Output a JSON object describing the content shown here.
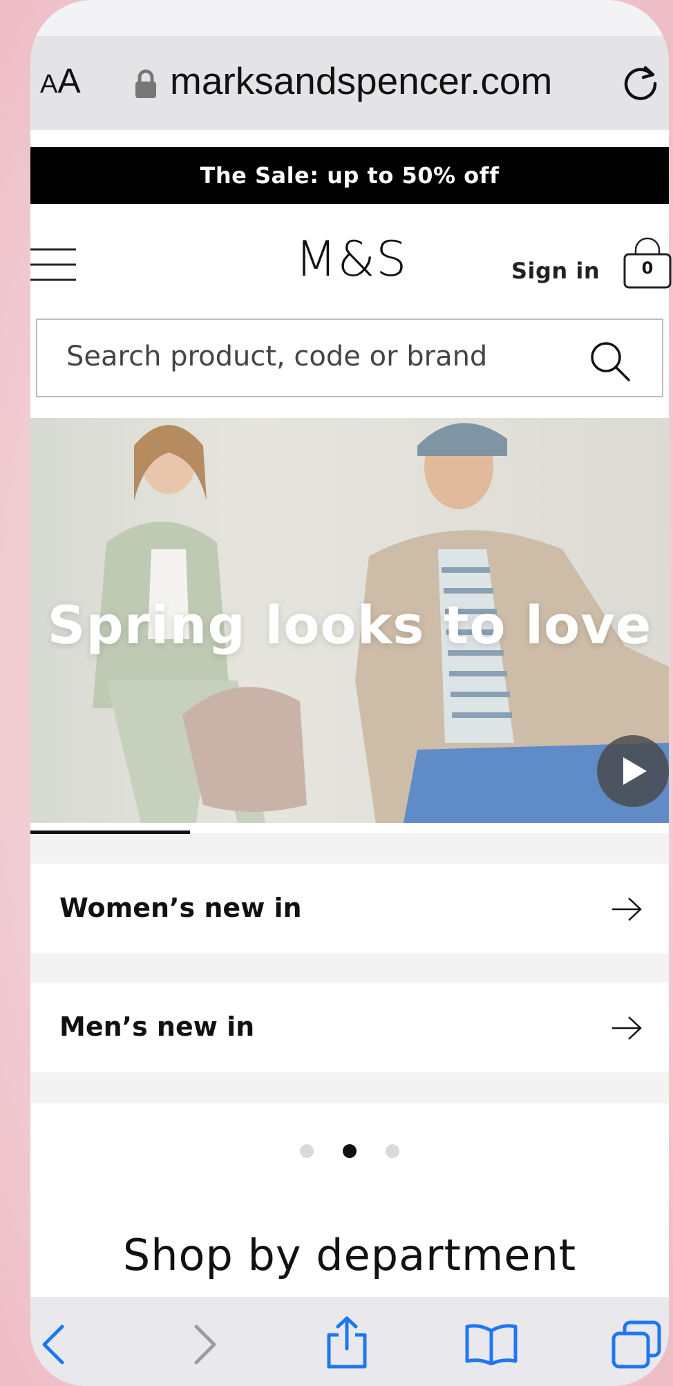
{
  "browser": {
    "text_size_label_small": "A",
    "text_size_label_large": "A",
    "url": "marksandspencer.com",
    "icons": [
      "lock-icon",
      "reload-icon",
      "back-icon",
      "forward-icon",
      "share-icon",
      "bookmarks-icon",
      "tabs-icon"
    ]
  },
  "banner": {
    "text": "The Sale: up to 50% off"
  },
  "header": {
    "logo": "M&S",
    "sign_in": "Sign in",
    "bag_count": "0"
  },
  "search": {
    "placeholder": "Search product, code or brand"
  },
  "hero": {
    "title": "Spring looks to love",
    "progress": 0.25
  },
  "links": [
    {
      "label": "Women’s new in"
    },
    {
      "label": "Men’s new in"
    }
  ],
  "carousel": {
    "dots": 3,
    "active_index": 1
  },
  "department": {
    "title": "Shop by department"
  },
  "colors": {
    "accent": "#000000",
    "ios_blue": "#1e77f2",
    "page_bg": "#f2c9cf"
  }
}
